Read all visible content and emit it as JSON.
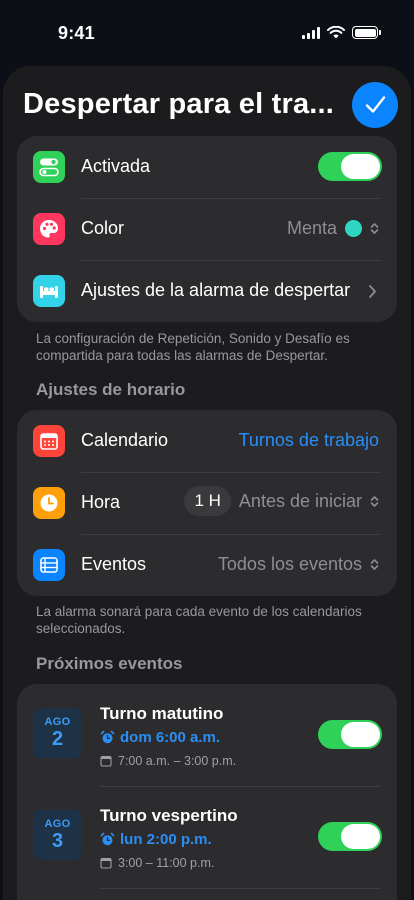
{
  "status_bar": {
    "time": "9:41"
  },
  "sheet": {
    "title": "Despertar para el tra..."
  },
  "settings": {
    "enabled_label": "Activada",
    "enabled": true,
    "color_label": "Color",
    "color_value": "Menta",
    "color_swatch": "#2fd6c1",
    "wake_settings_label": "Ajustes de la alarma de despertar",
    "footnote": "La configuración de Repetición, Sonido y Desafío es compartida para todas las alarmas de Despertar."
  },
  "schedule": {
    "header": "Ajustes de horario",
    "calendar_label": "Calendario",
    "calendar_value": "Turnos de trabajo",
    "time_label": "Hora",
    "time_offset": "1 H",
    "time_relation": "Antes de iniciar",
    "events_label": "Eventos",
    "events_value": "Todos los eventos",
    "footnote": "La alarma sonará para cada evento de los calendarios seleccionados."
  },
  "upcoming": {
    "header": "Próximos eventos",
    "events": [
      {
        "month": "AGO",
        "day": "2",
        "title": "Turno matutino",
        "alarm": "dom 6:00 a.m.",
        "time_range": "7:00 a.m. – 3:00 p.m.",
        "enabled": true
      },
      {
        "month": "AGO",
        "day": "3",
        "title": "Turno vespertino",
        "alarm": "lun 2:00 p.m.",
        "time_range": "3:00 – 11:00 p.m.",
        "enabled": true
      }
    ]
  },
  "colors": {
    "accent": "#0a84ff",
    "toggle_on": "#30d158",
    "icon_activada": "#30d158",
    "icon_color": "#ff375f",
    "icon_wake": "#32d2e8",
    "icon_calendar": "#ff453a",
    "icon_clock": "#ff9f0a",
    "icon_events": "#0a84ff"
  },
  "icons": {
    "activada": "toggles-icon",
    "color": "palette-icon",
    "wake": "bed-icon",
    "calendar": "calendar-icon",
    "time": "clock-icon",
    "events": "events-list-icon",
    "alarm": "alarm-clock-icon",
    "event_time": "calendar-small-icon"
  }
}
